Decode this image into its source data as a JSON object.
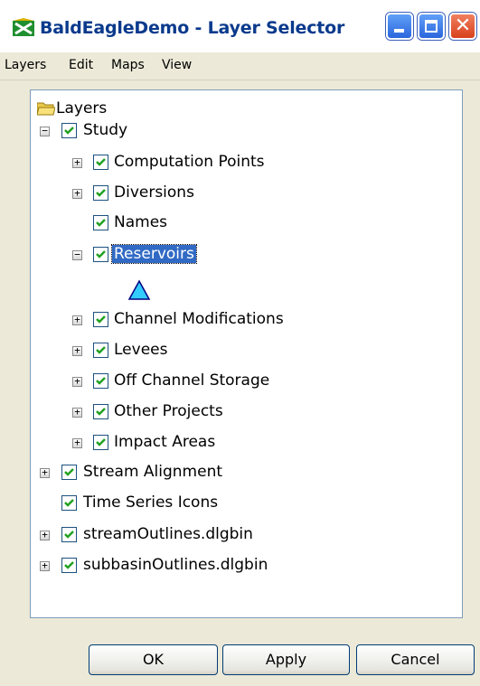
{
  "window": {
    "title": "BaldEagleDemo - Layer Selector"
  },
  "menu": [
    "Layers",
    "Edit",
    "Maps",
    "View"
  ],
  "tree": {
    "root": "Layers",
    "study": "Study",
    "computation_points": "Computation Points",
    "diversions": "Diversions",
    "names": "Names",
    "reservoirs": "Reservoirs",
    "channel_modifications": "Channel Modifications",
    "levees": "Levees",
    "off_channel_storage": "Off Channel Storage",
    "other_projects": "Other Projects",
    "impact_areas": "Impact Areas",
    "stream_alignment": "Stream Alignment",
    "time_series_icons": "Time Series Icons",
    "stream_outlines": "streamOutlines.dlgbin",
    "subbasin_outlines": "subbasinOutlines.dlgbin"
  },
  "buttons": {
    "ok": "OK",
    "apply": "Apply",
    "cancel": "Cancel"
  },
  "colors": {
    "accent": "#316ac5",
    "check": "#21a121",
    "reservoir_symbol": "#33ccff"
  }
}
